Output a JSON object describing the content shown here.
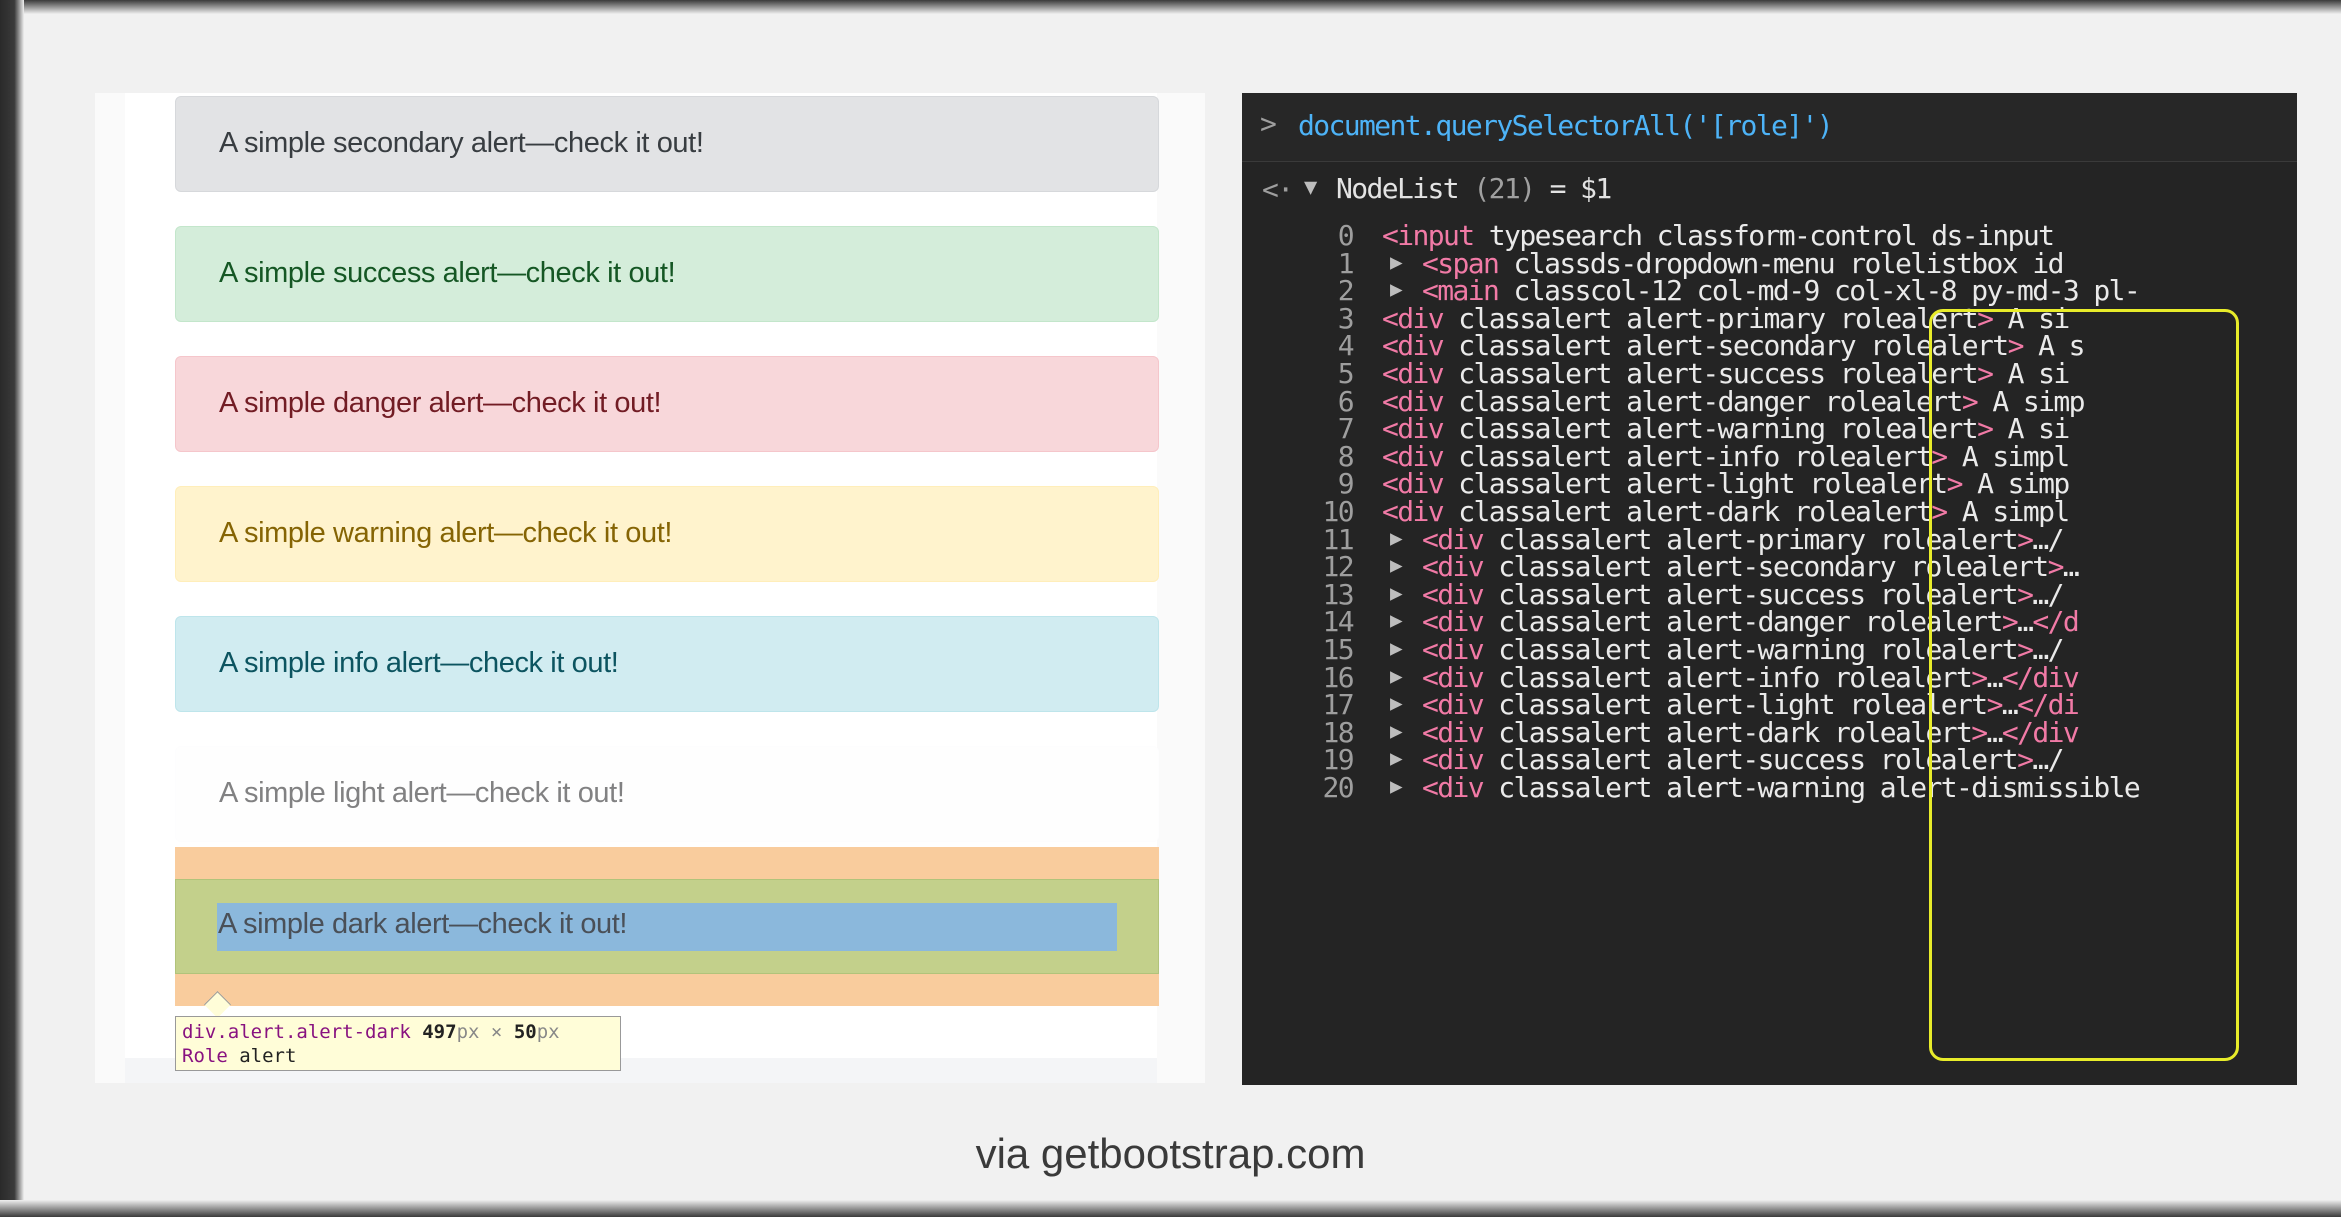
{
  "page": {
    "alerts": [
      {
        "variant": "secondary",
        "text": "A simple secondary alert—check it out!"
      },
      {
        "variant": "success",
        "text": "A simple success alert—check it out!"
      },
      {
        "variant": "danger",
        "text": "A simple danger alert—check it out!"
      },
      {
        "variant": "warning",
        "text": "A simple warning alert—check it out!"
      },
      {
        "variant": "info",
        "text": "A simple info alert—check it out!"
      },
      {
        "variant": "light",
        "text": "A simple light alert—check it out!"
      },
      {
        "variant": "dark",
        "text": "A simple dark alert—check it out!"
      }
    ],
    "inspector_tooltip": {
      "selector": "div.alert.alert-dark",
      "width": "497",
      "height": "50",
      "unit": "px",
      "times": "×",
      "role_label": "Role",
      "role_value": "alert"
    }
  },
  "console": {
    "prompt": ">",
    "command": "document.querySelectorAll('[role]')",
    "back_arrow": "<·",
    "result_name": "NodeList",
    "result_count": "(21)",
    "result_var": "= $1",
    "rows": [
      {
        "idx": "0",
        "html": "<input type=\"search\" class=\"form-control ds-input\""
      },
      {
        "idx": "1",
        "html": "<span class=\"ds-dropdown-menu\" role=\"listbox\" id="
      },
      {
        "idx": "2",
        "html": "<main class=\"col-12 col-md-9 col-xl-8 py-md-3 pl-"
      },
      {
        "idx": "3",
        "html": "<div class=\"alert alert-primary\" role=\"alert\"> A si"
      },
      {
        "idx": "4",
        "html": "<div class=\"alert alert-secondary\" role=\"alert\"> A s"
      },
      {
        "idx": "5",
        "html": "<div class=\"alert alert-success\" role=\"alert\"> A si"
      },
      {
        "idx": "6",
        "html": "<div class=\"alert alert-danger\" role=\"alert\"> A simp"
      },
      {
        "idx": "7",
        "html": "<div class=\"alert alert-warning\" role=\"alert\"> A si"
      },
      {
        "idx": "8",
        "html": "<div class=\"alert alert-info\" role=\"alert\"> A simpl"
      },
      {
        "idx": "9",
        "html": "<div class=\"alert alert-light\" role=\"alert\"> A simp"
      },
      {
        "idx": "10",
        "html": "<div class=\"alert alert-dark\" role=\"alert\"> A simpl"
      },
      {
        "idx": "11",
        "html": "<div class=\"alert alert-primary\" role=\"alert\">…</"
      },
      {
        "idx": "12",
        "html": "<div class=\"alert alert-secondary\" role=\"alert\">…"
      },
      {
        "idx": "13",
        "html": "<div class=\"alert alert-success\" role=\"alert\">…</"
      },
      {
        "idx": "14",
        "html": "<div class=\"alert alert-danger\" role=\"alert\">…</d"
      },
      {
        "idx": "15",
        "html": "<div class=\"alert alert-warning\" role=\"alert\">…</"
      },
      {
        "idx": "16",
        "html": "<div class=\"alert alert-info\" role=\"alert\">…</div"
      },
      {
        "idx": "17",
        "html": "<div class=\"alert alert-light\" role=\"alert\">…</di"
      },
      {
        "idx": "18",
        "html": "<div class=\"alert alert-dark\" role=\"alert\">…</div"
      },
      {
        "idx": "19",
        "html": "<div class=\"alert alert-success\" role=\"alert\">…</"
      },
      {
        "idx": "20",
        "html": "<div class=\"alert alert-warning alert-dismissible"
      }
    ]
  },
  "credit": "via getbootstrap.com",
  "colors": {
    "console_bg": "#242424",
    "tag": "#f17aa6",
    "attr": "#f5a35e",
    "value": "#f2c35c",
    "highlight_box": "#e8ec2a",
    "margin_overlay": "#f9cc9d",
    "padding_overlay": "#c3d08b",
    "content_overlay": "#8bb8dc"
  }
}
